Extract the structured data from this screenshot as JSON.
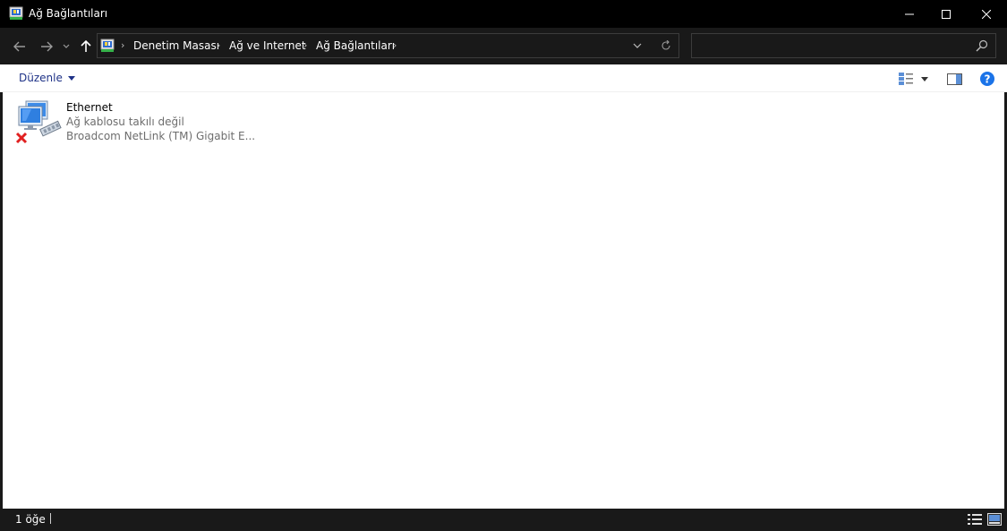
{
  "window": {
    "title": "Ağ Bağlantıları",
    "icon": "network-connections-icon"
  },
  "nav": {
    "breadcrumb": [
      "Denetim Masası",
      "Ağ ve Internet",
      "Ağ Bağlantıları"
    ],
    "search_placeholder": "",
    "search_value": ""
  },
  "commandbar": {
    "organize_label": "Düzenle"
  },
  "items": [
    {
      "name": "Ethernet",
      "status": "Ağ kablosu takılı değil",
      "device": "Broadcom NetLink (TM) Gigabit E..."
    }
  ],
  "statusbar": {
    "count": "1 öğe"
  },
  "colors": {
    "titlebar": "#000000",
    "chrome": "#191919",
    "content": "#ffffff",
    "link": "#1e3287",
    "help": "#1a73e8"
  }
}
